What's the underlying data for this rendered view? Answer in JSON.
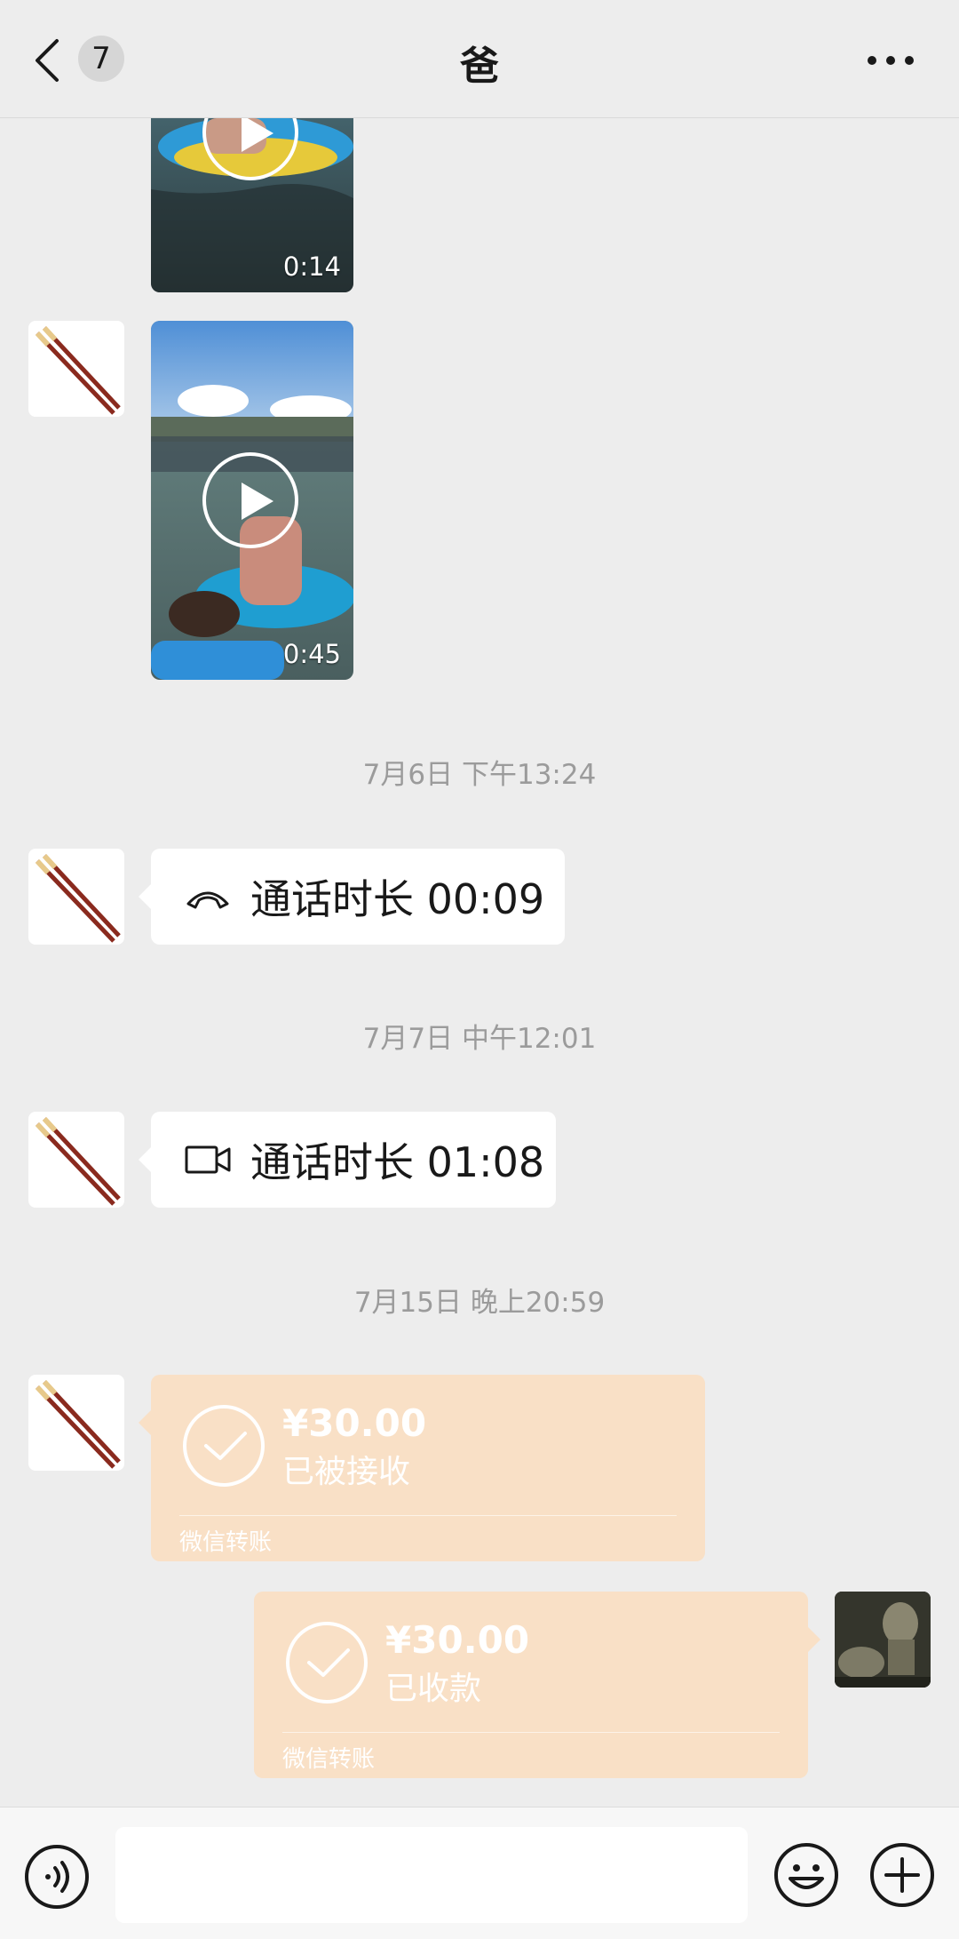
{
  "header": {
    "unread_count": "7",
    "title": "爸"
  },
  "messages": [
    {
      "type": "video",
      "duration": "0:14"
    },
    {
      "type": "video",
      "duration": "0:45"
    },
    {
      "type": "timestamp",
      "text": "7月6日 下午13:24"
    },
    {
      "type": "voice-call",
      "text": "通话时长 00:09",
      "icon": "phone-hangup-icon"
    },
    {
      "type": "timestamp",
      "text": "7月7日 中午12:01"
    },
    {
      "type": "video-call",
      "text": "通话时长 01:08",
      "icon": "video-camera-icon"
    },
    {
      "type": "timestamp",
      "text": "7月15日 晚上20:59"
    },
    {
      "type": "transfer",
      "amount": "¥30.00",
      "status": "已被接收",
      "footer": "微信转账",
      "side": "left"
    },
    {
      "type": "transfer",
      "amount": "¥30.00",
      "status": "已收款",
      "footer": "微信转账",
      "side": "right"
    }
  ],
  "input": {
    "placeholder": ""
  },
  "colors": {
    "background": "#ededed",
    "transfer_bubble": "#f9e0c6",
    "timestamp_text": "#9b9b9b"
  }
}
